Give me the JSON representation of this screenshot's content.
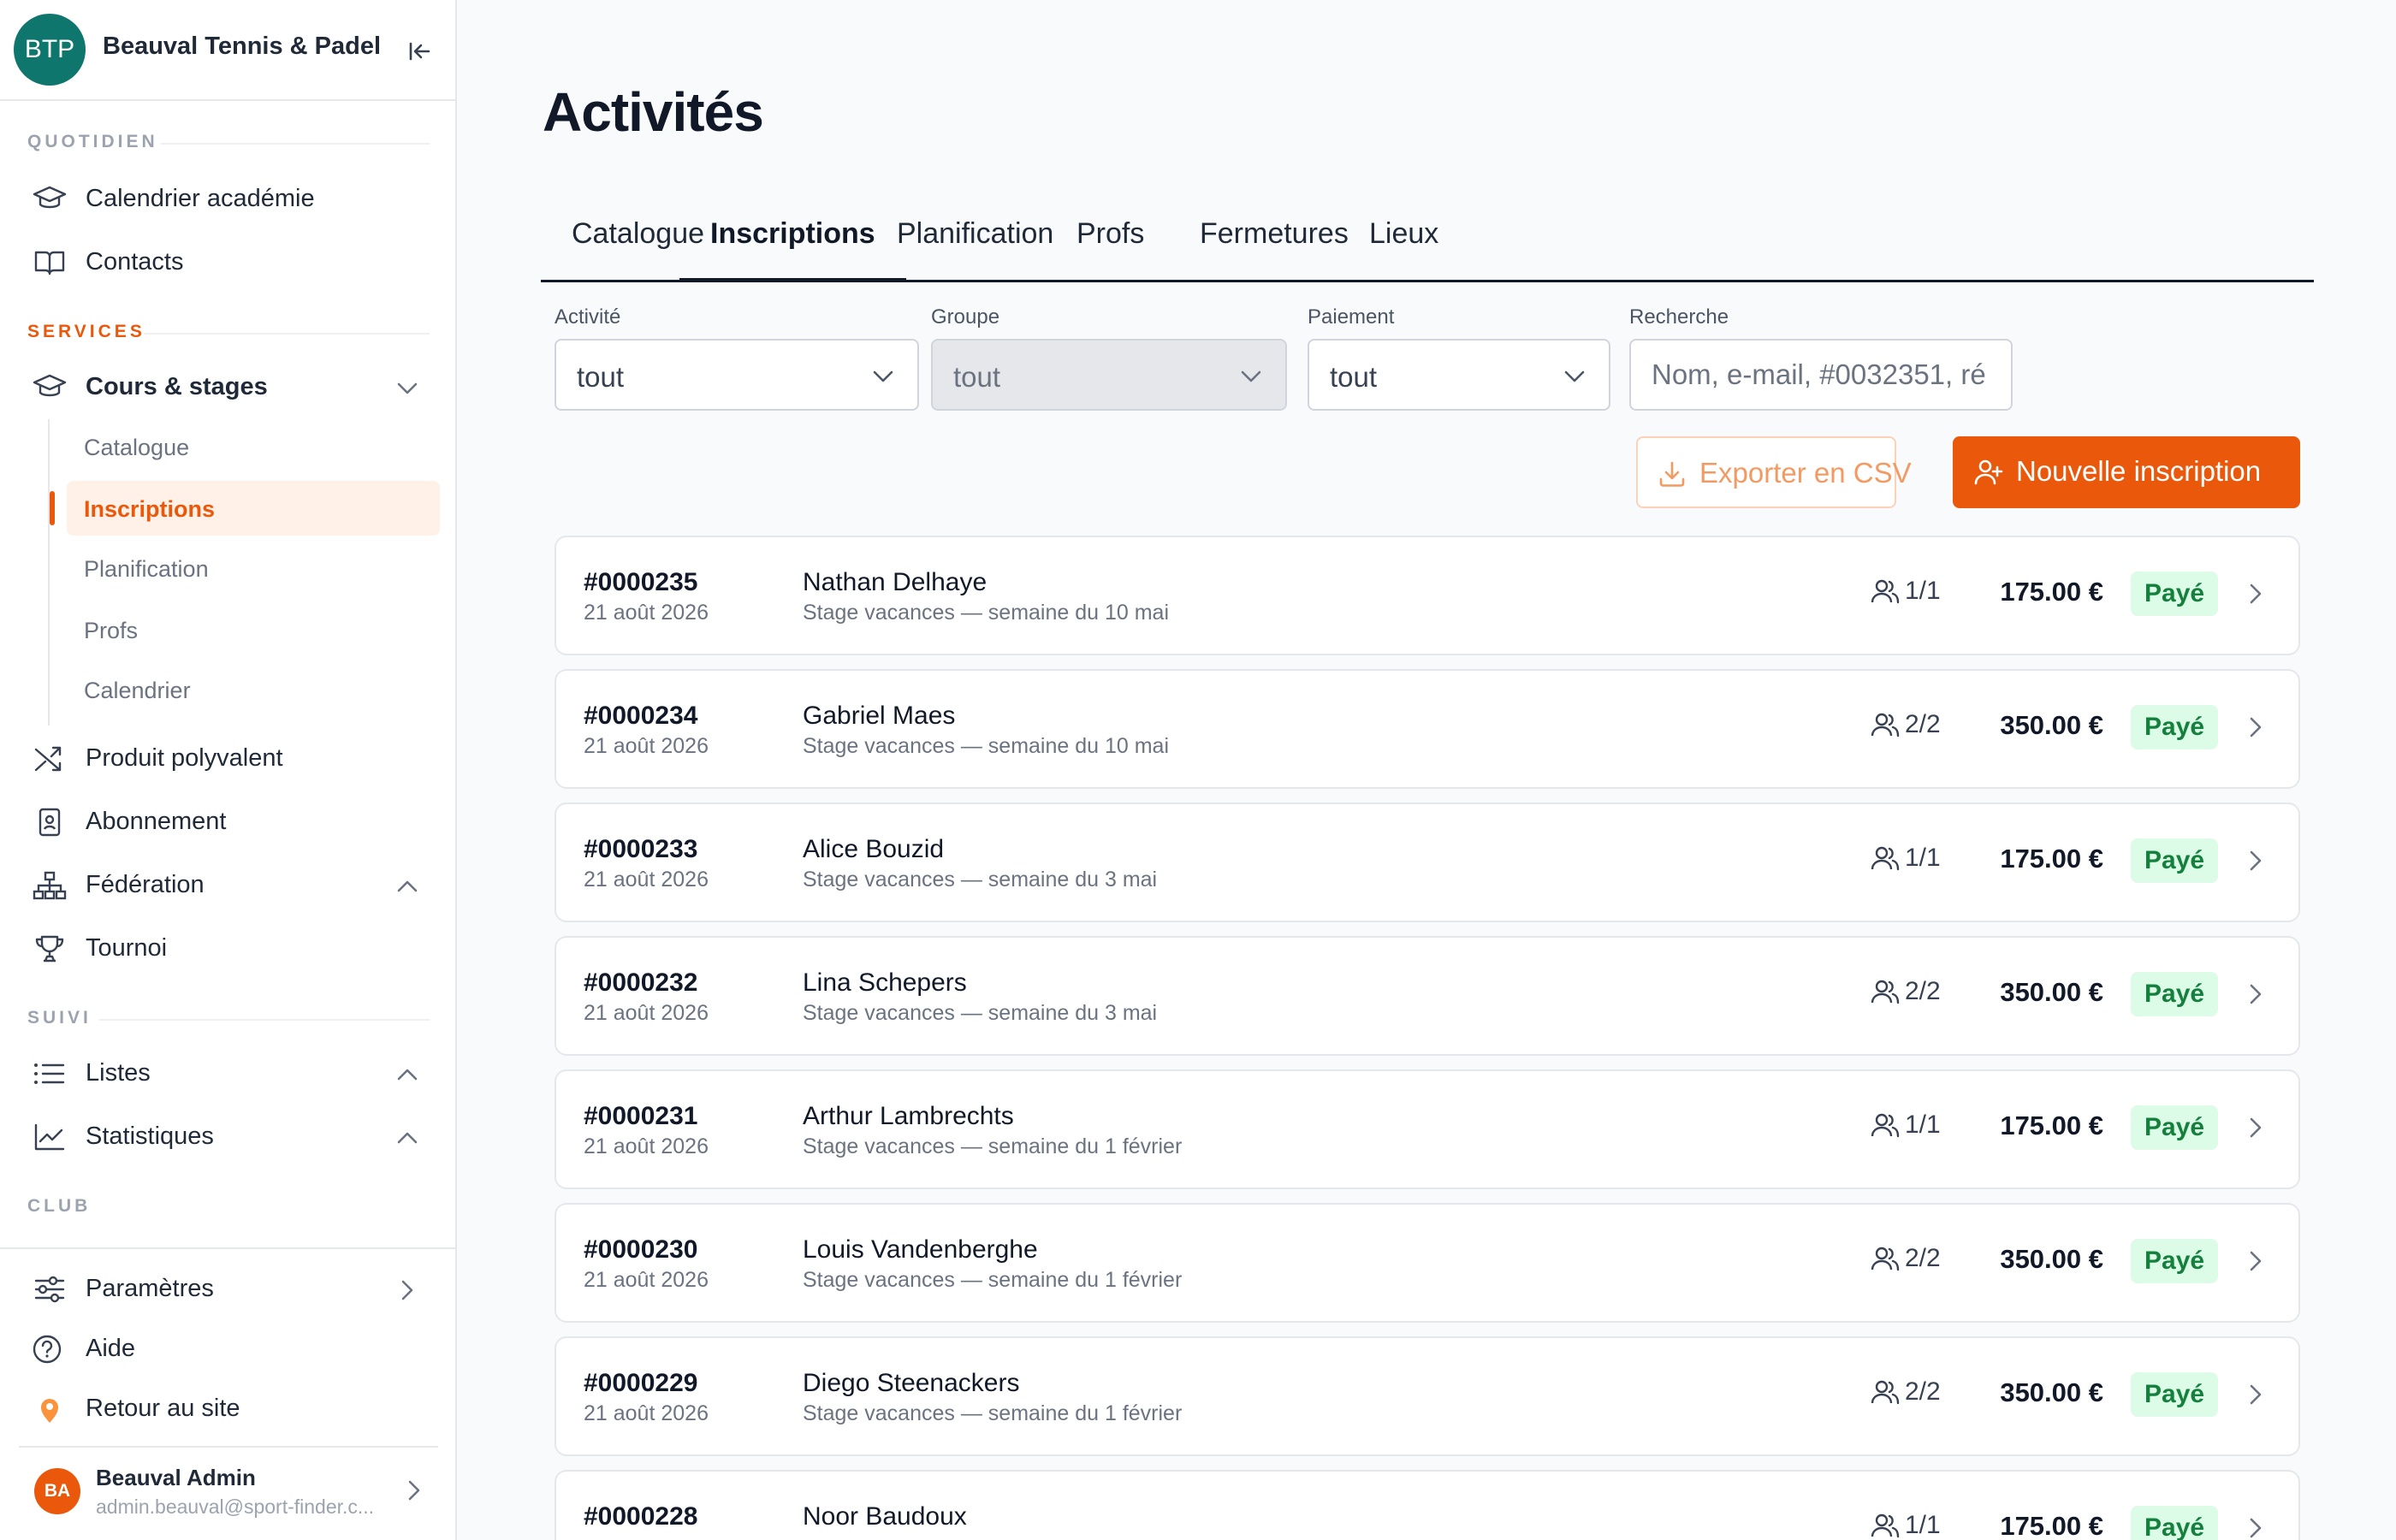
{
  "app": {
    "club_logo": "BTP",
    "club_name": "Beauval Tennis & Padel"
  },
  "sidebar": {
    "sections": {
      "quotidien": "QUOTIDIEN",
      "services": "SERVICES",
      "suivi": "SUIVI",
      "club": "CLUB"
    },
    "items": {
      "calendrier_academie": "Calendrier académie",
      "contacts": "Contacts",
      "cours_stages": "Cours & stages",
      "produit_polyvalent": "Produit polyvalent",
      "abonnement": "Abonnement",
      "federation": "Fédération",
      "tournoi": "Tournoi",
      "listes": "Listes",
      "statistiques": "Statistiques",
      "parametres": "Paramètres",
      "aide": "Aide",
      "retour_site": "Retour au site"
    },
    "sub_items": [
      "Catalogue",
      "Inscriptions",
      "Planification",
      "Profs",
      "Calendrier"
    ],
    "active_sub_item": "Inscriptions",
    "user": {
      "initials": "BA",
      "name": "Beauval Admin",
      "email": "admin.beauval@sport-finder.c..."
    }
  },
  "page": {
    "title": "Activités",
    "tabs": [
      "Catalogue",
      "Inscriptions",
      "Planification",
      "Profs",
      "Fermetures",
      "Lieux"
    ],
    "active_tab": "Inscriptions"
  },
  "filters": {
    "activite": {
      "label": "Activité",
      "value": "tout"
    },
    "groupe": {
      "label": "Groupe",
      "value": "tout",
      "disabled": true
    },
    "paiement": {
      "label": "Paiement",
      "value": "tout"
    },
    "recherche": {
      "label": "Recherche",
      "placeholder": "Nom, e-mail, #0032351, ré"
    }
  },
  "actions": {
    "export_csv": "Exporter en CSV",
    "new_registration": "Nouvelle inscription"
  },
  "registrations": [
    {
      "number": "#0000235",
      "date": "21 août 2026",
      "name": "Nathan Delhaye",
      "description": "Stage vacances — semaine du 10 mai",
      "participants": "1/1",
      "amount": "175.00 €",
      "status": "Payé"
    },
    {
      "number": "#0000234",
      "date": "21 août 2026",
      "name": "Gabriel Maes",
      "description": "Stage vacances — semaine du 10 mai",
      "participants": "2/2",
      "amount": "350.00 €",
      "status": "Payé"
    },
    {
      "number": "#0000233",
      "date": "21 août 2026",
      "name": "Alice Bouzid",
      "description": "Stage vacances — semaine du 3 mai",
      "participants": "1/1",
      "amount": "175.00 €",
      "status": "Payé"
    },
    {
      "number": "#0000232",
      "date": "21 août 2026",
      "name": "Lina Schepers",
      "description": "Stage vacances — semaine du 3 mai",
      "participants": "2/2",
      "amount": "350.00 €",
      "status": "Payé"
    },
    {
      "number": "#0000231",
      "date": "21 août 2026",
      "name": "Arthur Lambrechts",
      "description": "Stage vacances — semaine du 1 février",
      "participants": "1/1",
      "amount": "175.00 €",
      "status": "Payé"
    },
    {
      "number": "#0000230",
      "date": "21 août 2026",
      "name": "Louis Vandenberghe",
      "description": "Stage vacances — semaine du 1 février",
      "participants": "2/2",
      "amount": "350.00 €",
      "status": "Payé"
    },
    {
      "number": "#0000229",
      "date": "21 août 2026",
      "name": "Diego Steenackers",
      "description": "Stage vacances — semaine du 1 février",
      "participants": "2/2",
      "amount": "350.00 €",
      "status": "Payé"
    },
    {
      "number": "#0000228",
      "date": "",
      "name": "Noor Baudoux",
      "description": "",
      "participants": "1/1",
      "amount": "175.00 €",
      "status": "Payé"
    }
  ],
  "colors": {
    "accent": "#ea580c",
    "accent_light": "#fff1e7",
    "paid_bg": "#dcfce7",
    "paid_text": "#15803d",
    "logo_bg": "#0f766e"
  }
}
